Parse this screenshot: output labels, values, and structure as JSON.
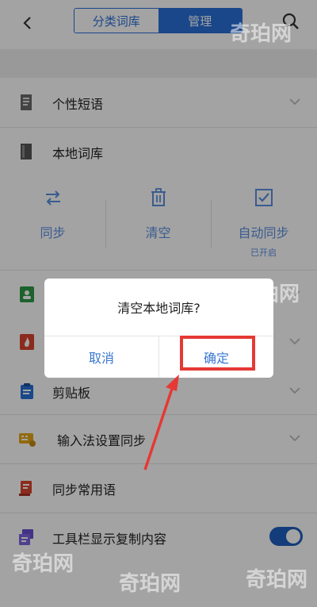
{
  "header": {
    "tabs": [
      {
        "label": "分类词库",
        "active": false
      },
      {
        "label": "管理",
        "active": true
      }
    ]
  },
  "list": {
    "personal_phrases": "个性短语",
    "local_dict": "本地词库",
    "clipboard": "剪贴板",
    "ime_sync": "输入法设置同步",
    "common_phrases": "同步常用语",
    "toolbar_copy": "工具栏显示复制内容"
  },
  "actions": {
    "sync": "同步",
    "clear": "清空",
    "auto_sync": "自动同步",
    "auto_sync_status": "已开启"
  },
  "toggle": {
    "toolbar_copy_on": true
  },
  "dialog": {
    "message": "清空本地词库?",
    "cancel": "取消",
    "confirm": "确定"
  },
  "watermarks": [
    "奇珀网",
    "奇珀网",
    "奇珀网",
    "奇珀网",
    "奇珀网"
  ],
  "colors": {
    "accent": "#2a70d8",
    "highlight": "#e53935",
    "toggle": "#1f5fbf"
  }
}
